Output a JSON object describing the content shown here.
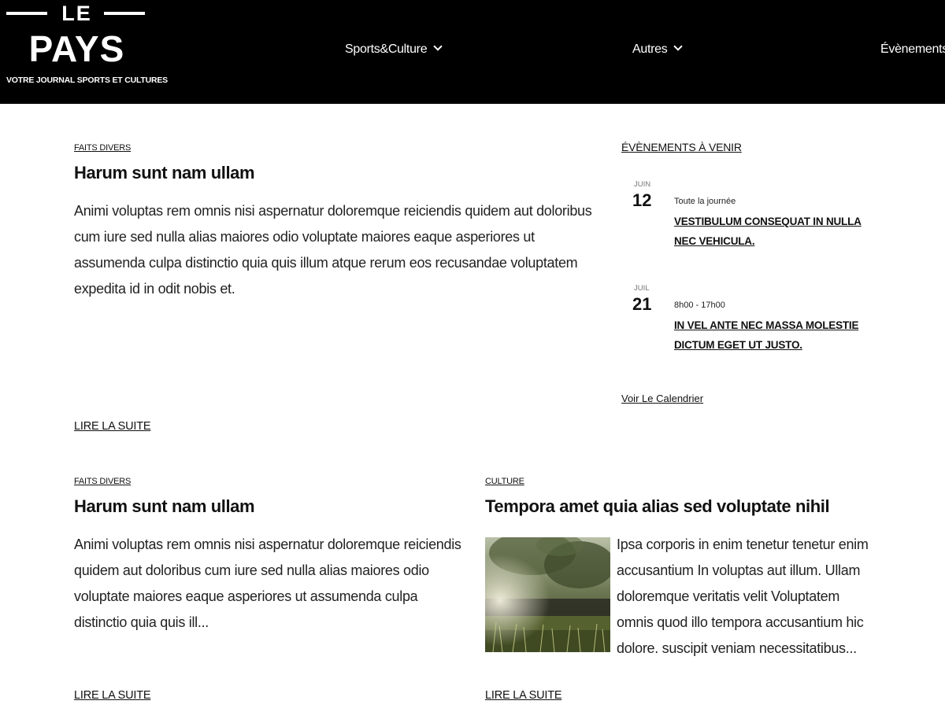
{
  "header": {
    "logo": {
      "le": "LE",
      "pays": "PAYS",
      "tagline": "VOTRE JOURNAL SPORTS ET CULTURES"
    },
    "nav": [
      {
        "label": "Sports&Culture",
        "icon": "chevron-down-icon"
      },
      {
        "label": "Autres",
        "icon": "chevron-down-icon"
      },
      {
        "label": "Évènements"
      }
    ]
  },
  "featured": {
    "category": "FAITS DIVERS",
    "title": "Harum sunt nam ullam",
    "excerpt": "Animi voluptas rem omnis nisi aspernatur doloremque reiciendis quidem aut doloribus cum iure sed nulla alias maiores odio voluptate maiores eaque asperiores ut assumenda culpa distinctio quia quis illum atque rerum eos recusandae voluptatem expedita id in odit nobis et.",
    "read_more": "LIRE LA SUITE"
  },
  "sidebar": {
    "title": "ÉVÈNEMENTS À VENIR",
    "events": [
      {
        "month": "JUIN",
        "day": "12",
        "time": "Toute la journée",
        "title": "VESTIBULUM CONSEQUAT IN NULLA NEC VEHICULA."
      },
      {
        "month": "JUIL",
        "day": "21",
        "time": "8h00 - 17h00",
        "title": "IN VEL ANTE NEC MASSA MOLESTIE DICTUM EGET UT JUSTO."
      }
    ],
    "calendar_link": "Voir Le Calendrier"
  },
  "articles": [
    {
      "category": "FAITS DIVERS",
      "title": "Harum sunt nam ullam",
      "excerpt": "Animi voluptas rem omnis nisi aspernatur doloremque reiciendis quidem aut doloribus cum iure sed nulla alias maiores odio voluptate maiores eaque asperiores ut assumenda culpa distinctio quia quis ill...",
      "read_more": "LIRE LA SUITE"
    },
    {
      "category": "CULTURE",
      "title": "Tempora amet quia alias sed voluptate nihil",
      "excerpt": "Ipsa corporis in enim tenetur tenetur enim accusantium In voluptas aut illum. Ullam doloremque veritatis velit Voluptatem omnis quod illo tempora accusantium hic dolore. suscipit veniam necessitatibus...",
      "read_more": "LIRE LA SUITE",
      "image": "grass-landscape-photo"
    }
  ],
  "colors": {
    "header_bg": "#000000",
    "text": "#111111",
    "muted": "#777777",
    "page_bg": "#ffffff"
  }
}
